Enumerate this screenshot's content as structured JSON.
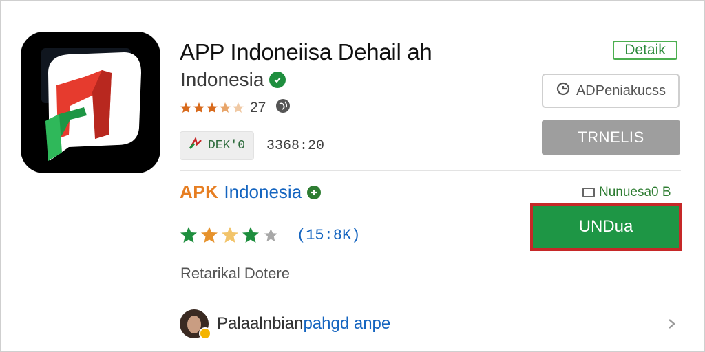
{
  "app": {
    "title": "APP Indoneiisa Dehail ah",
    "developer": "Indonesia",
    "rating_count": "27",
    "badge_label": "DEK'0",
    "meta": "3368:20"
  },
  "actions": {
    "details_tag": "Detaik",
    "secondary_button": "ADPeniakucss",
    "gray_button": "TRNELIS"
  },
  "listing": {
    "brand": "APK",
    "name": "Indonesia",
    "version": "Nunuesa0 B",
    "reviews_count": "(15:8K)",
    "install_label": "UNDua",
    "caption": "Retarikal Dotere"
  },
  "review": {
    "author": "Palaalnbian",
    "text": "pahgd anpe"
  },
  "colors": {
    "install_green": "#1e9645",
    "install_border": "#c62828",
    "link_blue": "#1565c0",
    "brand_orange": "#e67e22",
    "star_orange": "#e67e22",
    "star_green": "#1e8e3e"
  },
  "ratings": {
    "top_stars": 3.5,
    "listing_stars": 3.5
  }
}
